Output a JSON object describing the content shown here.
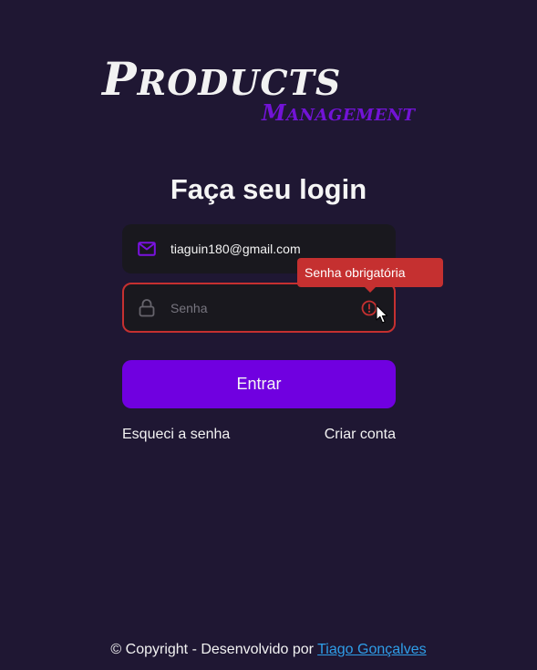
{
  "logo": {
    "main_cap": "P",
    "main_rest": "RODUCTS",
    "sub_cap": "M",
    "sub_rest": "ANAGEMENT"
  },
  "title": "Faça seu login",
  "form": {
    "email_value": "tiaguin180@gmail.com",
    "password_placeholder": "Senha",
    "error_tooltip": "Senha obrigatória",
    "submit_label": "Entrar"
  },
  "links": {
    "forgot": "Esqueci a senha",
    "create": "Criar conta"
  },
  "footer": {
    "text": "© Copyright - Desenvolvido por ",
    "author": "Tiago Gonçalves"
  },
  "colors": {
    "background": "#1f1733",
    "accent": "#7000e0",
    "error": "#c53030",
    "input_bg": "#19181e",
    "link": "#2f9ee8"
  },
  "icons": {
    "email": "mail-icon",
    "password": "lock-icon",
    "error": "alert-circle-icon"
  }
}
